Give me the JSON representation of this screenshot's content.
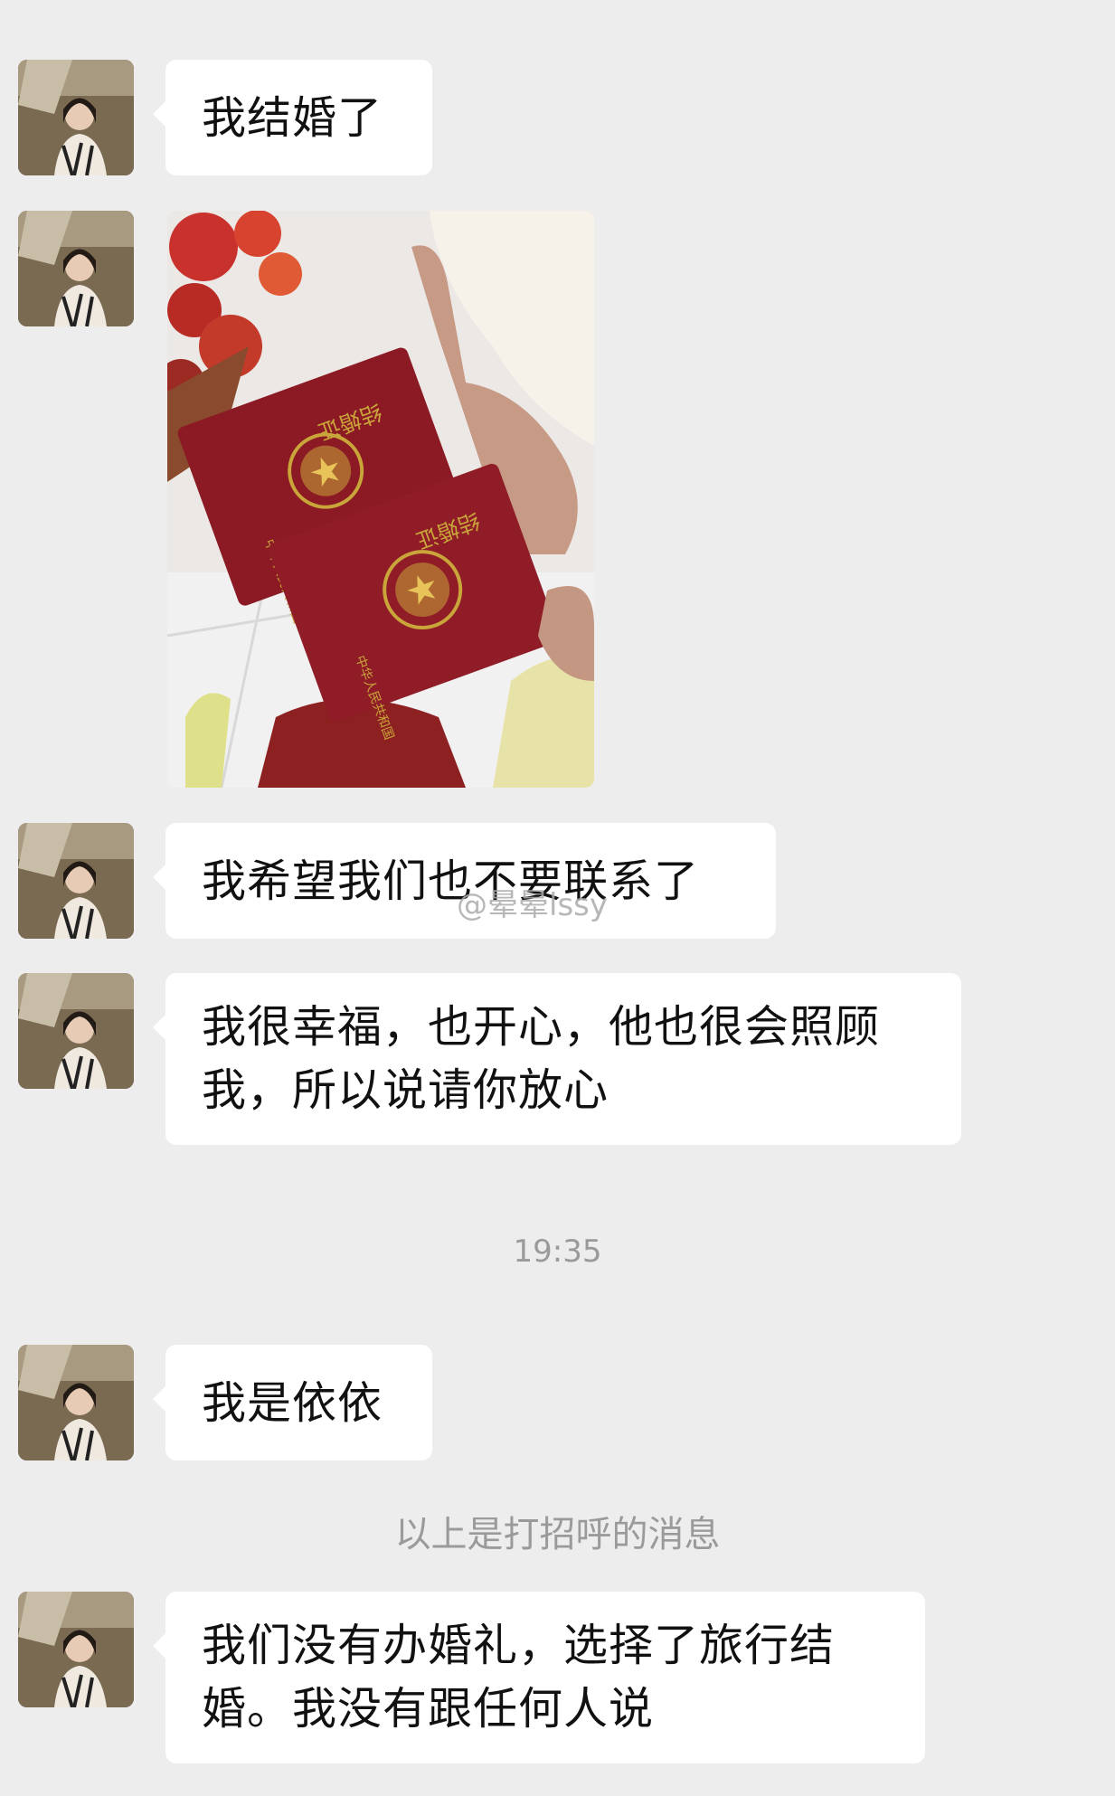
{
  "messages": [
    {
      "type": "text",
      "text": "我结婚了"
    },
    {
      "type": "image",
      "image_alt": "两本红色结婚证"
    },
    {
      "type": "text",
      "text": "我希望我们也不要联系了"
    },
    {
      "type": "text",
      "line1": "我很幸福，也开心，他也很会照顾",
      "line2": "我，所以说请你放心"
    },
    {
      "type": "text",
      "text": "我是依依"
    },
    {
      "type": "text",
      "line1": "我们没有办婚礼，选择了旅行结",
      "line2": "婚。我没有跟任何人说"
    }
  ],
  "timestamp": "19:35",
  "system_notice": "以上是打招呼的消息",
  "watermark": "@晕晕lssy",
  "certificate": {
    "title": "结婚证",
    "issuer": "中华人民共和国"
  },
  "colors": {
    "background": "#ededed",
    "bubble": "#ffffff",
    "certificate": "#8b1a24",
    "emblem": "#c9a53a"
  },
  "icons": {
    "avatar": "avatar-photo",
    "emblem": "national-emblem-icon"
  }
}
